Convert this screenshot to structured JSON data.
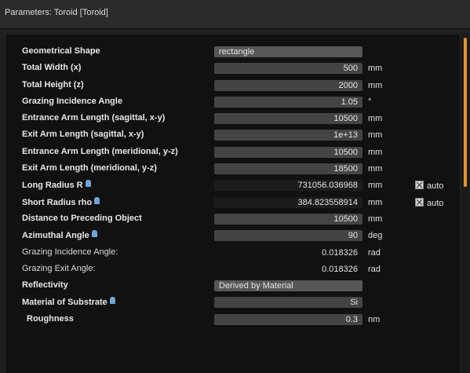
{
  "window": {
    "title": "Parameters: Toroid [Toroid]"
  },
  "rows": [
    {
      "label": "Geometrical Shape",
      "value": "rectangle",
      "unit": "",
      "kind": "dropdown",
      "bold": true,
      "info": false
    },
    {
      "label": "Total Width (x)",
      "value": "500",
      "unit": "mm",
      "kind": "input",
      "bold": true,
      "info": false
    },
    {
      "label": "Total Height (z)",
      "value": "2000",
      "unit": "mm",
      "kind": "input",
      "bold": true,
      "info": false
    },
    {
      "label": "Grazing Incidence Angle",
      "value": "1.05",
      "unit": "°",
      "kind": "input",
      "bold": true,
      "info": false
    },
    {
      "label": "Entrance Arm Length (sagittal, x-y)",
      "value": "10500",
      "unit": "mm",
      "kind": "input",
      "bold": true,
      "info": false
    },
    {
      "label": "Exit Arm Length (sagittal, x-y)",
      "value": "1e+13",
      "unit": "mm",
      "kind": "input",
      "bold": true,
      "info": false
    },
    {
      "label": "Entrance Arm Length (meridional, y-z)",
      "value": "10500",
      "unit": "mm",
      "kind": "input",
      "bold": true,
      "info": false
    },
    {
      "label": "Exit Arm Length (meridional, y-z)",
      "value": "18500",
      "unit": "mm",
      "kind": "input",
      "bold": true,
      "info": false
    },
    {
      "label": "Long Radius R",
      "value": "731056.036968",
      "unit": "mm",
      "kind": "dark",
      "bold": true,
      "info": true,
      "auto_label": "auto",
      "auto_checked": true
    },
    {
      "label": "Short Radius rho",
      "value": "384.823558914",
      "unit": "mm",
      "kind": "dark",
      "bold": true,
      "info": true,
      "auto_label": "auto",
      "auto_checked": true
    },
    {
      "label": "Distance to Preceding Object",
      "value": "10500",
      "unit": "mm",
      "kind": "input",
      "bold": true,
      "info": false
    },
    {
      "label": "Azimuthal Angle",
      "value": "90",
      "unit": "deg",
      "kind": "input",
      "bold": true,
      "info": true
    },
    {
      "label": "Grazing Incidence Angle:",
      "value": "0.018326",
      "unit": "rad",
      "kind": "readonly",
      "bold": false,
      "info": false
    },
    {
      "label": "Grazing Exit Angle:",
      "value": "0.018326",
      "unit": "rad",
      "kind": "readonly",
      "bold": false,
      "info": false
    },
    {
      "label": "Reflectivity",
      "value": "Derived by Material",
      "unit": "",
      "kind": "dropdown",
      "bold": true,
      "info": false
    },
    {
      "label": "Material of Substrate",
      "value": "Si",
      "unit": "",
      "kind": "input",
      "bold": true,
      "info": true
    },
    {
      "label": "Roughness",
      "value": "0.3",
      "unit": "nm",
      "kind": "input",
      "bold": true,
      "info": false,
      "indent": true
    }
  ]
}
